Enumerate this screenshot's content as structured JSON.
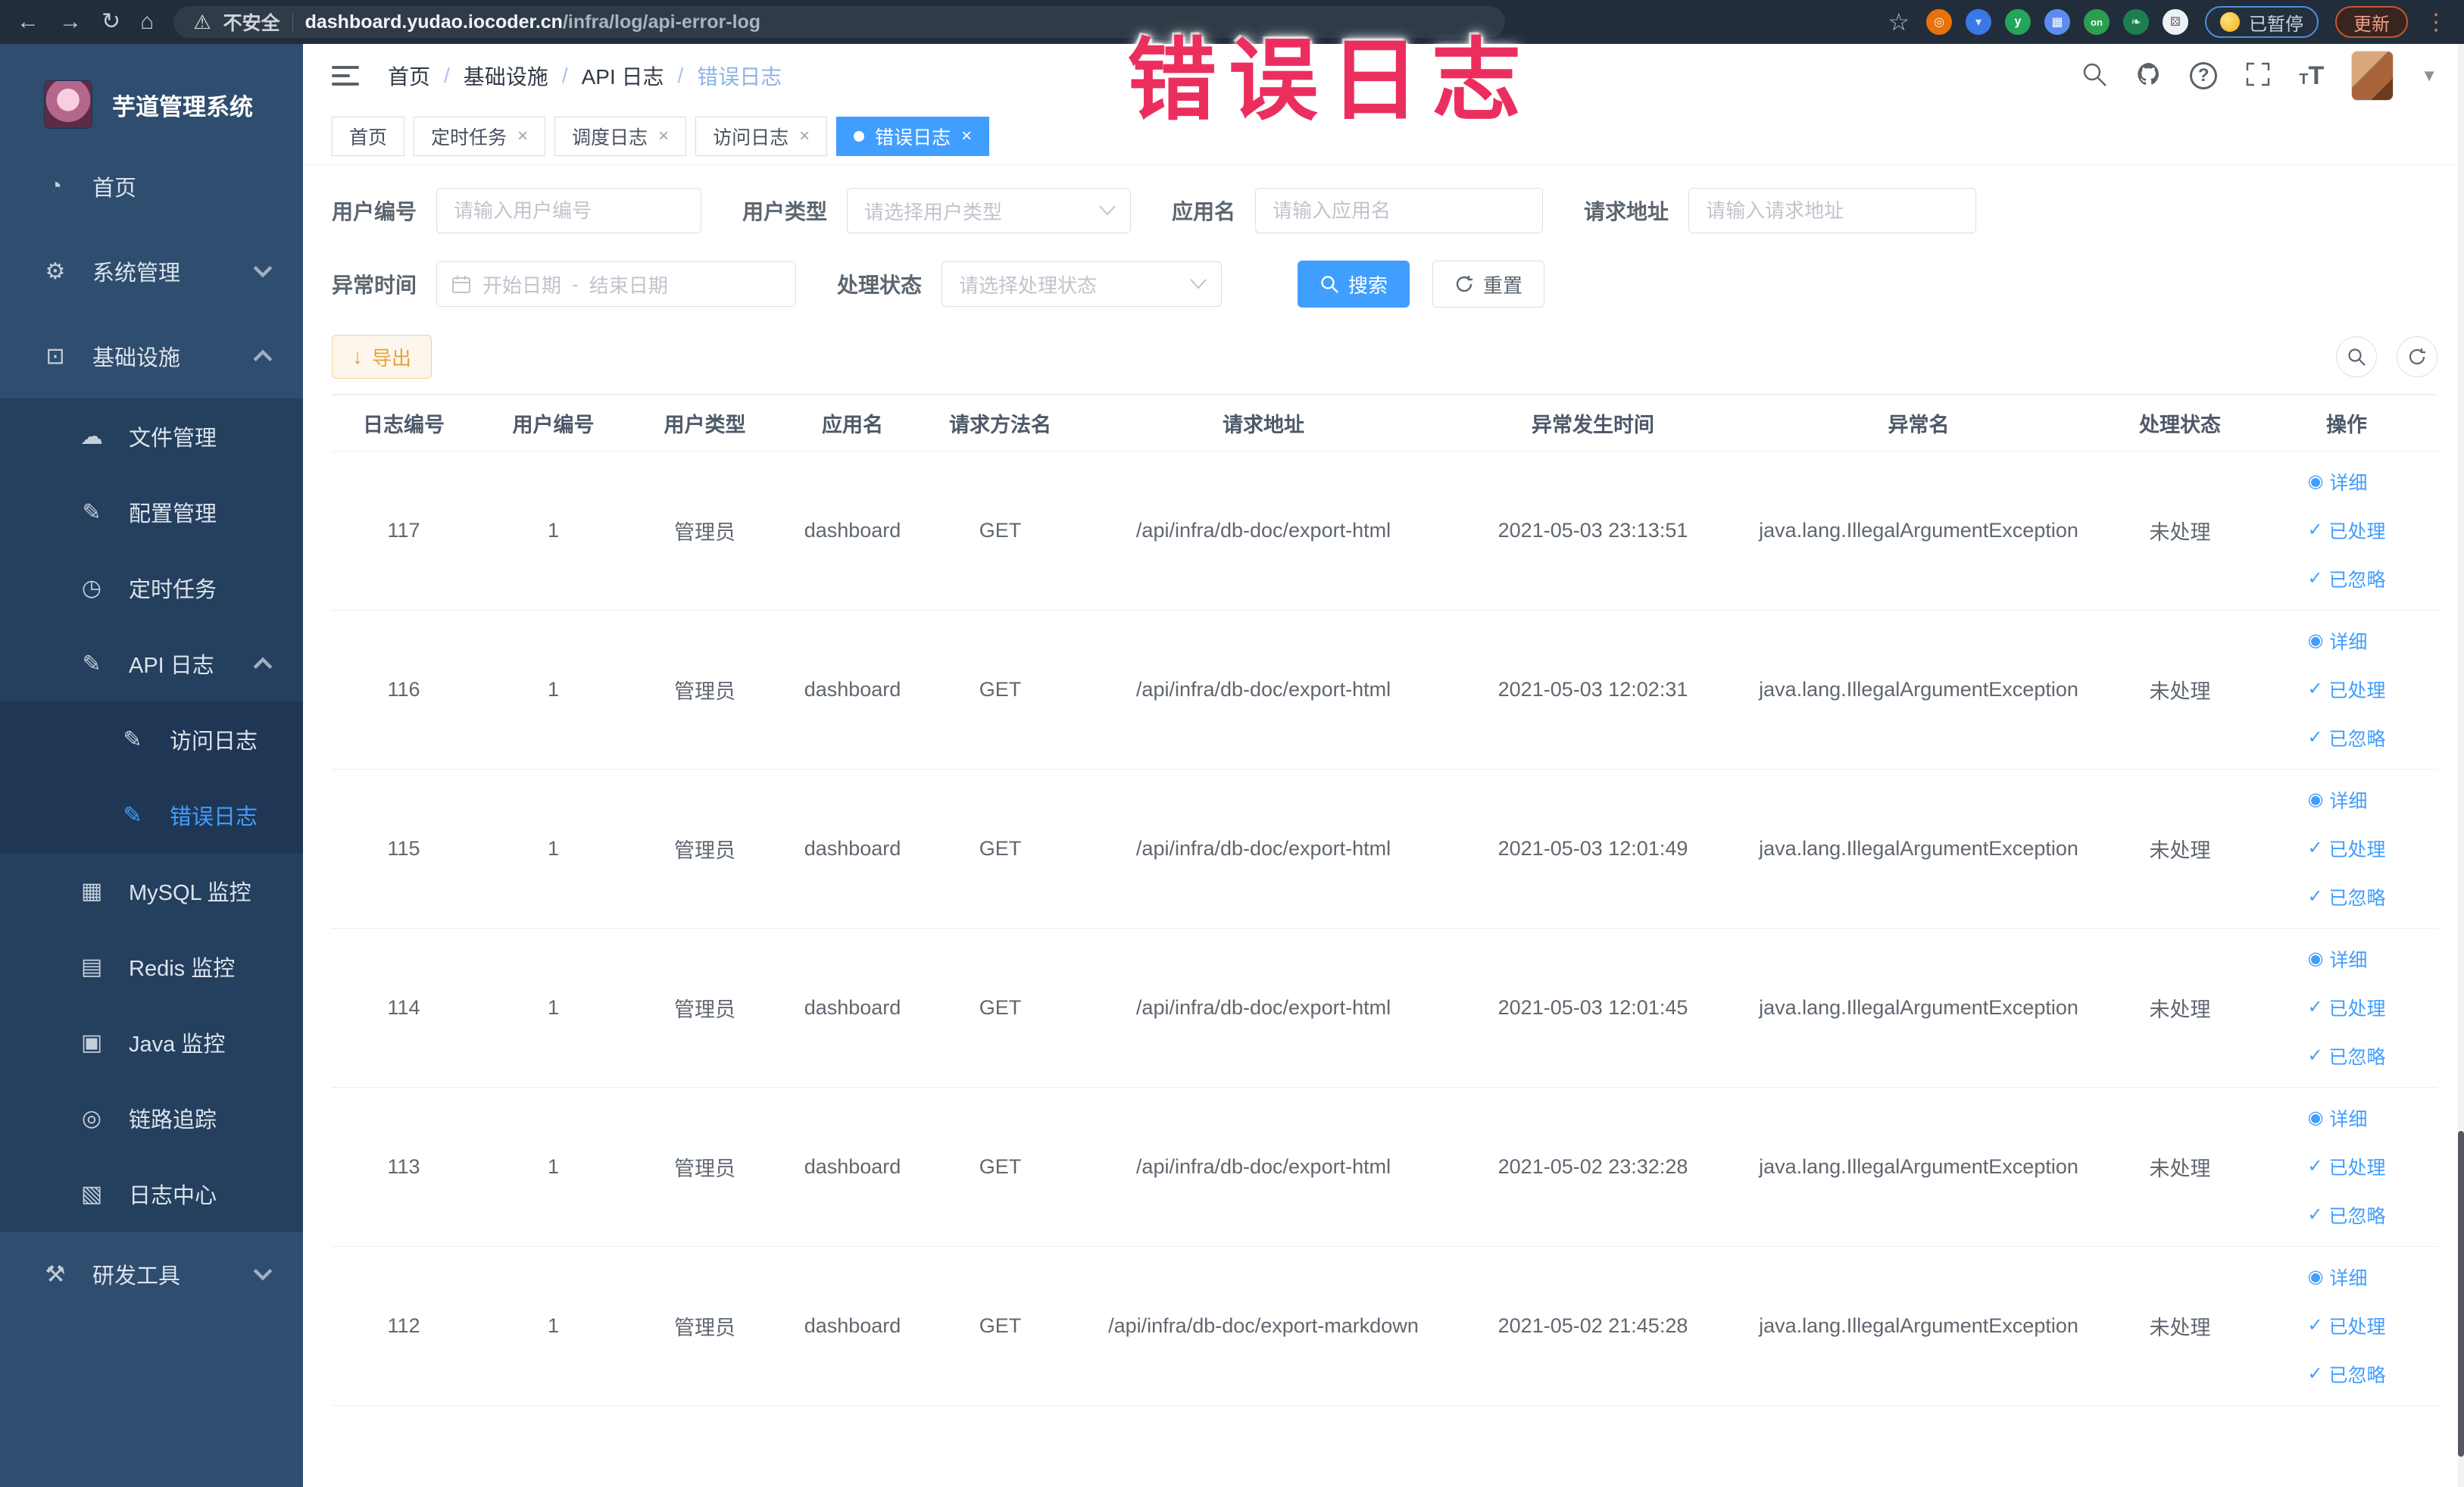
{
  "colors": {
    "accent": "#409eff",
    "watermark": "#ec2e5e",
    "warning": "#e6a23c",
    "sidebar": "#2f4d6e"
  },
  "browser": {
    "security_text": "不安全",
    "url_domain": "dashboard.yudao.iocoder.cn",
    "url_path": "/infra/log/api-error-log",
    "paused_label": "已暂停",
    "update_label": "更新",
    "extensions": [
      {
        "name": "target-extension-icon",
        "bg": "#e8710a",
        "glyph": "◎",
        "fg": "#fff3e6"
      },
      {
        "name": "shield-extension-icon",
        "bg": "#3b78e7",
        "glyph": "▾",
        "fg": "#dce7ff"
      },
      {
        "name": "y-extension-icon",
        "bg": "#23a55a",
        "glyph": "y",
        "fg": "#ffffff"
      },
      {
        "name": "grid-extension-icon",
        "bg": "#5b8def",
        "glyph": "▦",
        "fg": "#ffffff"
      },
      {
        "name": "on-badge-extension-icon",
        "bg": "#2d9e4f",
        "glyph": "on",
        "fg": "#eafff0"
      },
      {
        "name": "leaf-extension-icon",
        "bg": "#1d7d4f",
        "glyph": "❧",
        "fg": "#d9ffe8"
      },
      {
        "name": "puzzle-extension-icon",
        "bg": "#eef1f4",
        "glyph": "⚄",
        "fg": "#5a6268"
      }
    ]
  },
  "watermark": {
    "text": "错误日志"
  },
  "sidebar": {
    "title": "芋道管理系统",
    "menu": [
      {
        "label": "首页",
        "icon": "home-icon",
        "glyph": "◔",
        "level": 1
      },
      {
        "label": "系统管理",
        "icon": "gear-icon",
        "glyph": "⚙",
        "level": 1,
        "chevron": "down"
      },
      {
        "label": "基础设施",
        "icon": "infrastructure-icon",
        "glyph": "⊡",
        "level": 1,
        "chevron": "up"
      },
      {
        "label": "文件管理",
        "icon": "cloud-upload-icon",
        "glyph": "☁",
        "level": 2
      },
      {
        "label": "配置管理",
        "icon": "edit-icon",
        "glyph": "✎",
        "level": 2
      },
      {
        "label": "定时任务",
        "icon": "clock-icon",
        "glyph": "◷",
        "level": 2
      },
      {
        "label": "API 日志",
        "icon": "log-icon",
        "glyph": "✎",
        "level": 2,
        "chevron": "up"
      },
      {
        "label": "访问日志",
        "icon": "access-log-icon",
        "glyph": "✎",
        "level": 3
      },
      {
        "label": "错误日志",
        "icon": "error-log-icon",
        "glyph": "✎",
        "level": 3,
        "active": true
      },
      {
        "label": "MySQL 监控",
        "icon": "mysql-icon",
        "glyph": "▦",
        "level": 2
      },
      {
        "label": "Redis 监控",
        "icon": "redis-icon",
        "glyph": "▤",
        "level": 2
      },
      {
        "label": "Java 监控",
        "icon": "java-icon",
        "glyph": "▣",
        "level": 2
      },
      {
        "label": "链路追踪",
        "icon": "trace-icon",
        "glyph": "◎",
        "level": 2
      },
      {
        "label": "日志中心",
        "icon": "log-center-icon",
        "glyph": "▧",
        "level": 2
      },
      {
        "label": "研发工具",
        "icon": "tools-icon",
        "glyph": "⚒",
        "level": 1,
        "chevron": "down"
      }
    ]
  },
  "header": {
    "breadcrumbs": [
      "首页",
      "基础设施",
      "API 日志",
      "错误日志"
    ]
  },
  "tabs": [
    {
      "label": "首页",
      "closable": false,
      "active": false
    },
    {
      "label": "定时任务",
      "closable": true,
      "active": false
    },
    {
      "label": "调度日志",
      "closable": true,
      "active": false
    },
    {
      "label": "访问日志",
      "closable": true,
      "active": false
    },
    {
      "label": "错误日志",
      "closable": true,
      "active": true
    }
  ],
  "filters": {
    "user_id": {
      "label": "用户编号",
      "placeholder": "请输入用户编号"
    },
    "user_type": {
      "label": "用户类型",
      "placeholder": "请选择用户类型"
    },
    "app_name": {
      "label": "应用名",
      "placeholder": "请输入应用名"
    },
    "request_url": {
      "label": "请求地址",
      "placeholder": "请输入请求地址"
    },
    "exception_time": {
      "label": "异常时间",
      "start_placeholder": "开始日期",
      "separator": "-",
      "end_placeholder": "结束日期"
    },
    "process_status": {
      "label": "处理状态",
      "placeholder": "请选择处理状态"
    },
    "search_label": "搜索",
    "reset_label": "重置"
  },
  "toolbar": {
    "export_label": "导出"
  },
  "table": {
    "columns": [
      "日志编号",
      "用户编号",
      "用户类型",
      "应用名",
      "请求方法名",
      "请求地址",
      "异常发生时间",
      "异常名",
      "处理状态",
      "操作"
    ],
    "actions": [
      {
        "label": "详细",
        "icon": "view-icon",
        "glyph": "◉"
      },
      {
        "label": "已处理",
        "icon": "check-icon",
        "glyph": "✓"
      },
      {
        "label": "已忽略",
        "icon": "check-icon",
        "glyph": "✓"
      }
    ],
    "rows": [
      {
        "id": "117",
        "user_id": "1",
        "user_type": "管理员",
        "app": "dashboard",
        "method": "GET",
        "url": "/api/infra/db-doc/export-html",
        "time": "2021-05-03 23:13:51",
        "exception": "java.lang.IllegalArgumentException",
        "status": "未处理"
      },
      {
        "id": "116",
        "user_id": "1",
        "user_type": "管理员",
        "app": "dashboard",
        "method": "GET",
        "url": "/api/infra/db-doc/export-html",
        "time": "2021-05-03 12:02:31",
        "exception": "java.lang.IllegalArgumentException",
        "status": "未处理"
      },
      {
        "id": "115",
        "user_id": "1",
        "user_type": "管理员",
        "app": "dashboard",
        "method": "GET",
        "url": "/api/infra/db-doc/export-html",
        "time": "2021-05-03 12:01:49",
        "exception": "java.lang.IllegalArgumentException",
        "status": "未处理"
      },
      {
        "id": "114",
        "user_id": "1",
        "user_type": "管理员",
        "app": "dashboard",
        "method": "GET",
        "url": "/api/infra/db-doc/export-html",
        "time": "2021-05-03 12:01:45",
        "exception": "java.lang.IllegalArgumentException",
        "status": "未处理"
      },
      {
        "id": "113",
        "user_id": "1",
        "user_type": "管理员",
        "app": "dashboard",
        "method": "GET",
        "url": "/api/infra/db-doc/export-html",
        "time": "2021-05-02 23:32:28",
        "exception": "java.lang.IllegalArgumentException",
        "status": "未处理"
      },
      {
        "id": "112",
        "user_id": "1",
        "user_type": "管理员",
        "app": "dashboard",
        "method": "GET",
        "url": "/api/infra/db-doc/export-markdown",
        "time": "2021-05-02 21:45:28",
        "exception": "java.lang.IllegalArgumentException",
        "status": "未处理"
      }
    ]
  }
}
